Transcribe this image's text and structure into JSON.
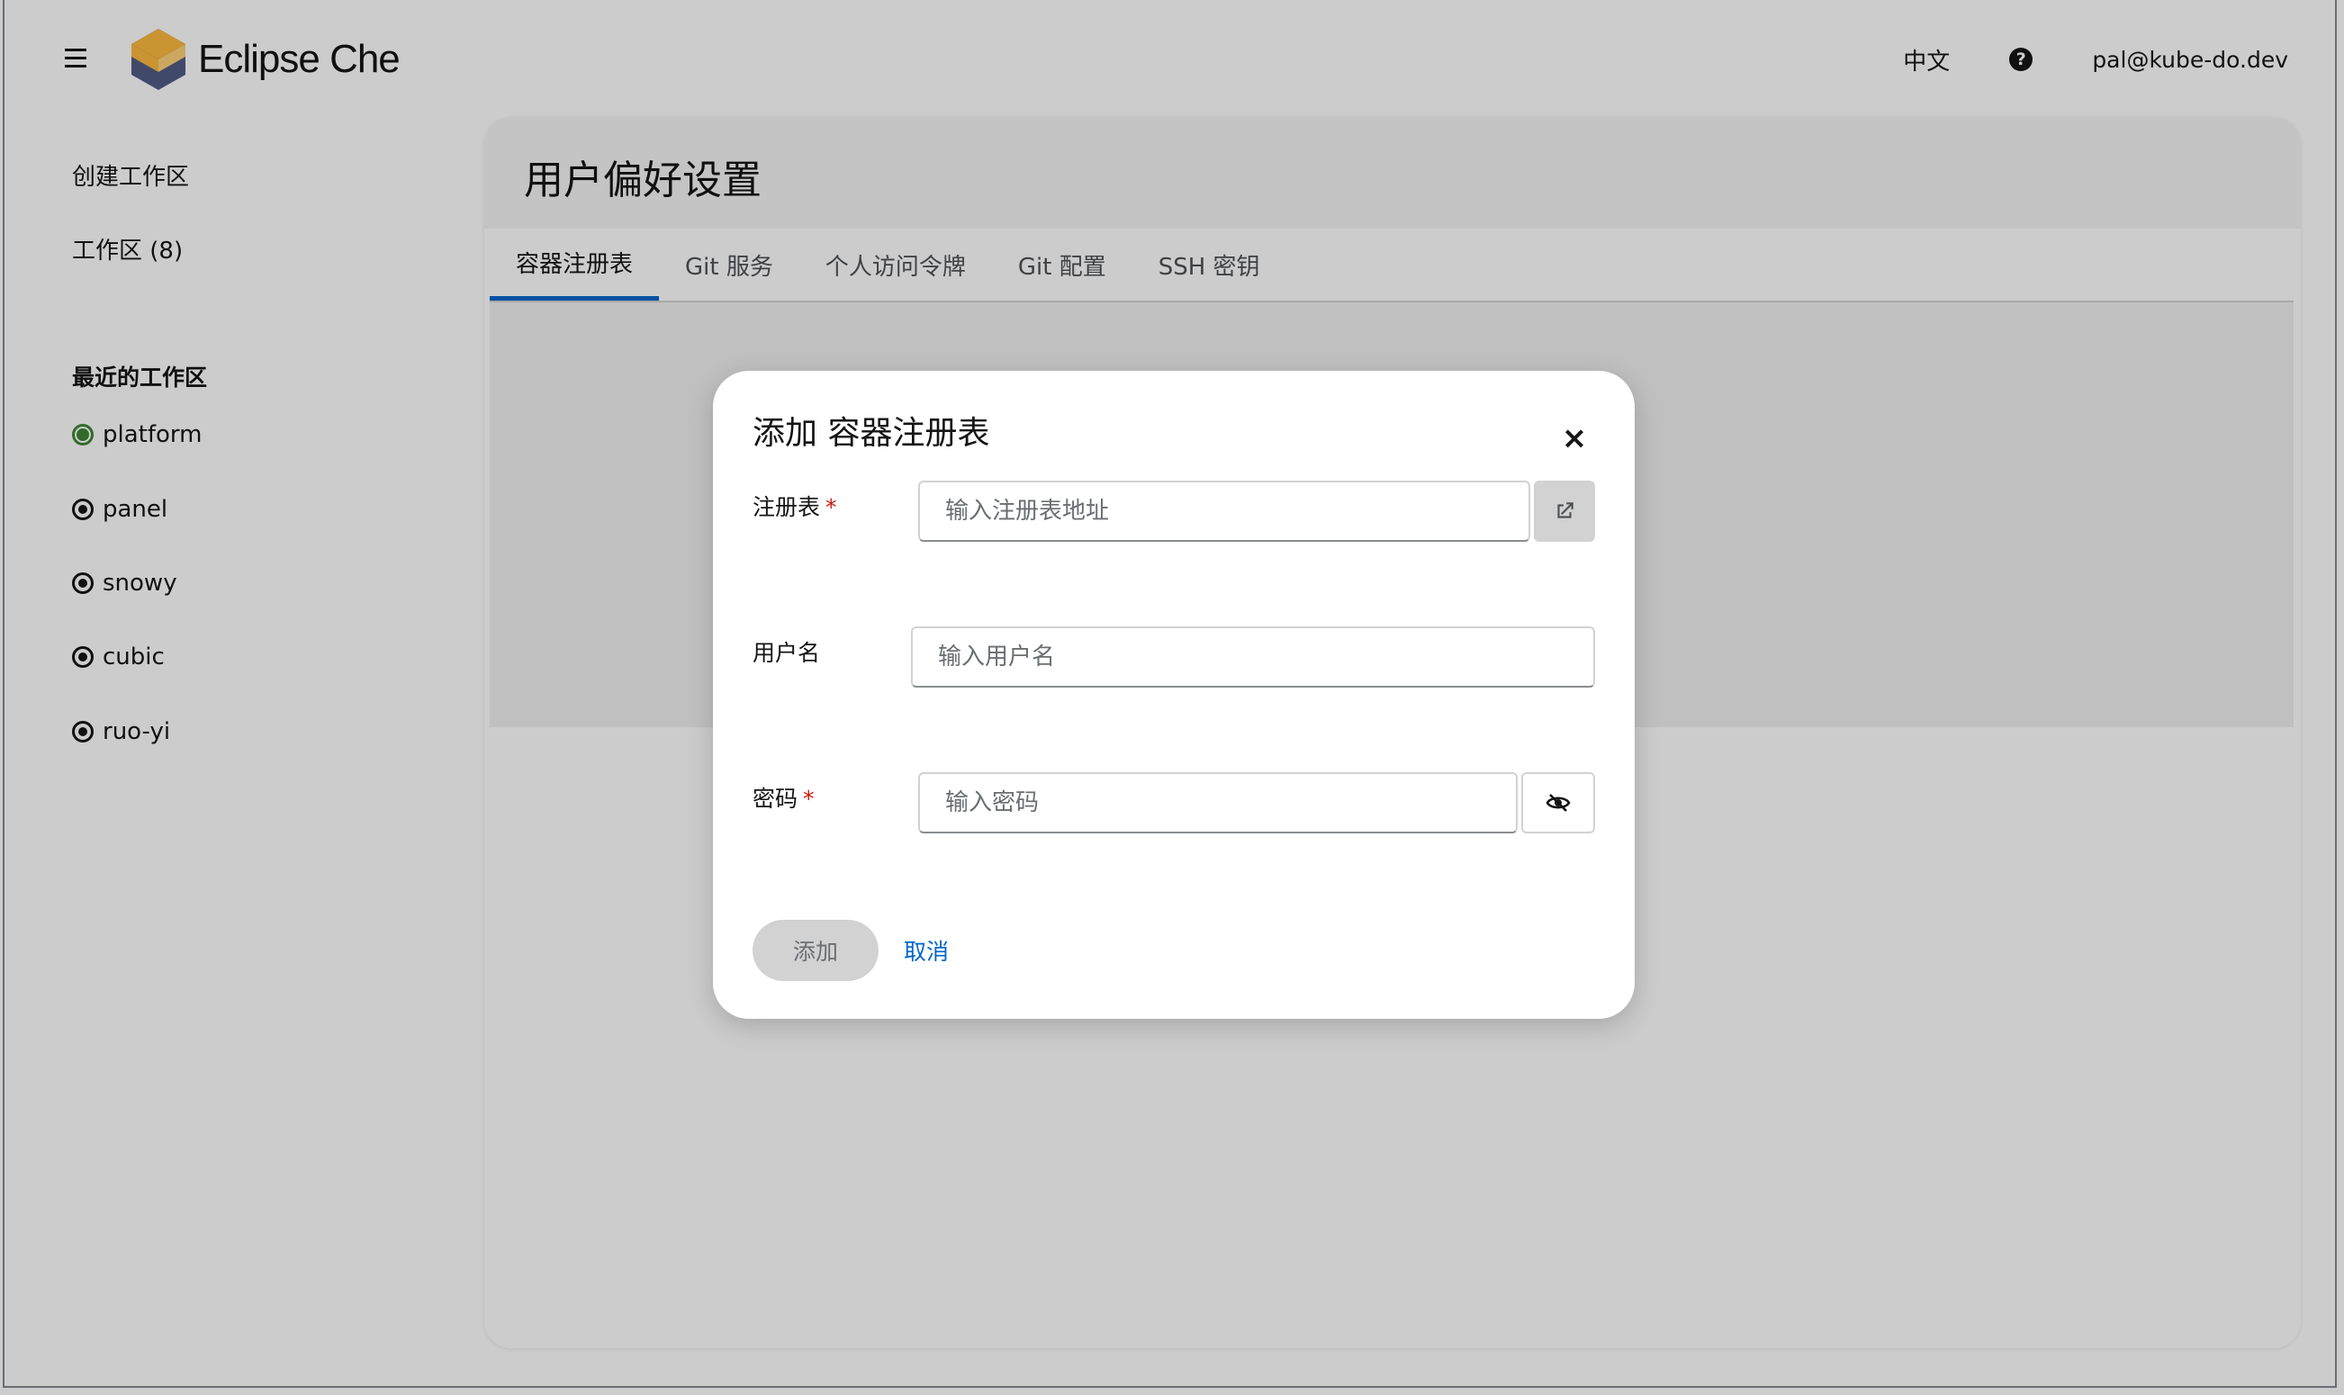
{
  "header": {
    "brand": "Eclipse Che",
    "language": "中文",
    "user": "pal@kube-do.dev"
  },
  "sidebar": {
    "nav": [
      {
        "label": "创建工作区"
      },
      {
        "label": "工作区 (8)"
      }
    ],
    "recent_title": "最近的工作区",
    "recent": [
      {
        "name": "platform",
        "status": "running"
      },
      {
        "name": "panel",
        "status": "stopped"
      },
      {
        "name": "snowy",
        "status": "stopped"
      },
      {
        "name": "cubic",
        "status": "stopped"
      },
      {
        "name": "ruo-yi",
        "status": "stopped"
      }
    ]
  },
  "main": {
    "title": "用户偏好设置",
    "tabs": [
      {
        "label": "容器注册表",
        "active": true
      },
      {
        "label": "Git 服务",
        "active": false
      },
      {
        "label": "个人访问令牌",
        "active": false
      },
      {
        "label": "Git 配置",
        "active": false
      },
      {
        "label": "SSH 密钥",
        "active": false
      }
    ]
  },
  "modal": {
    "title": "添加 容器注册表",
    "registry": {
      "label": "注册表",
      "required_mark": "*",
      "placeholder": "输入注册表地址",
      "value": ""
    },
    "username": {
      "label": "用户名",
      "placeholder": "输入用户名",
      "value": ""
    },
    "password": {
      "label": "密码",
      "required_mark": "*",
      "placeholder": "输入密码",
      "value": ""
    },
    "add_label": "添加",
    "cancel_label": "取消"
  },
  "colors": {
    "accent": "#0066cc",
    "running": "#3e8635",
    "required": "#c9190b",
    "logo_orange": "#fdb940",
    "logo_navy": "#525c86"
  },
  "icons": {
    "menu": "hamburger-icon",
    "help": "question-circle-icon",
    "close": "close-icon",
    "open_link": "external-link-icon",
    "toggle_password": "eye-slash-icon"
  }
}
